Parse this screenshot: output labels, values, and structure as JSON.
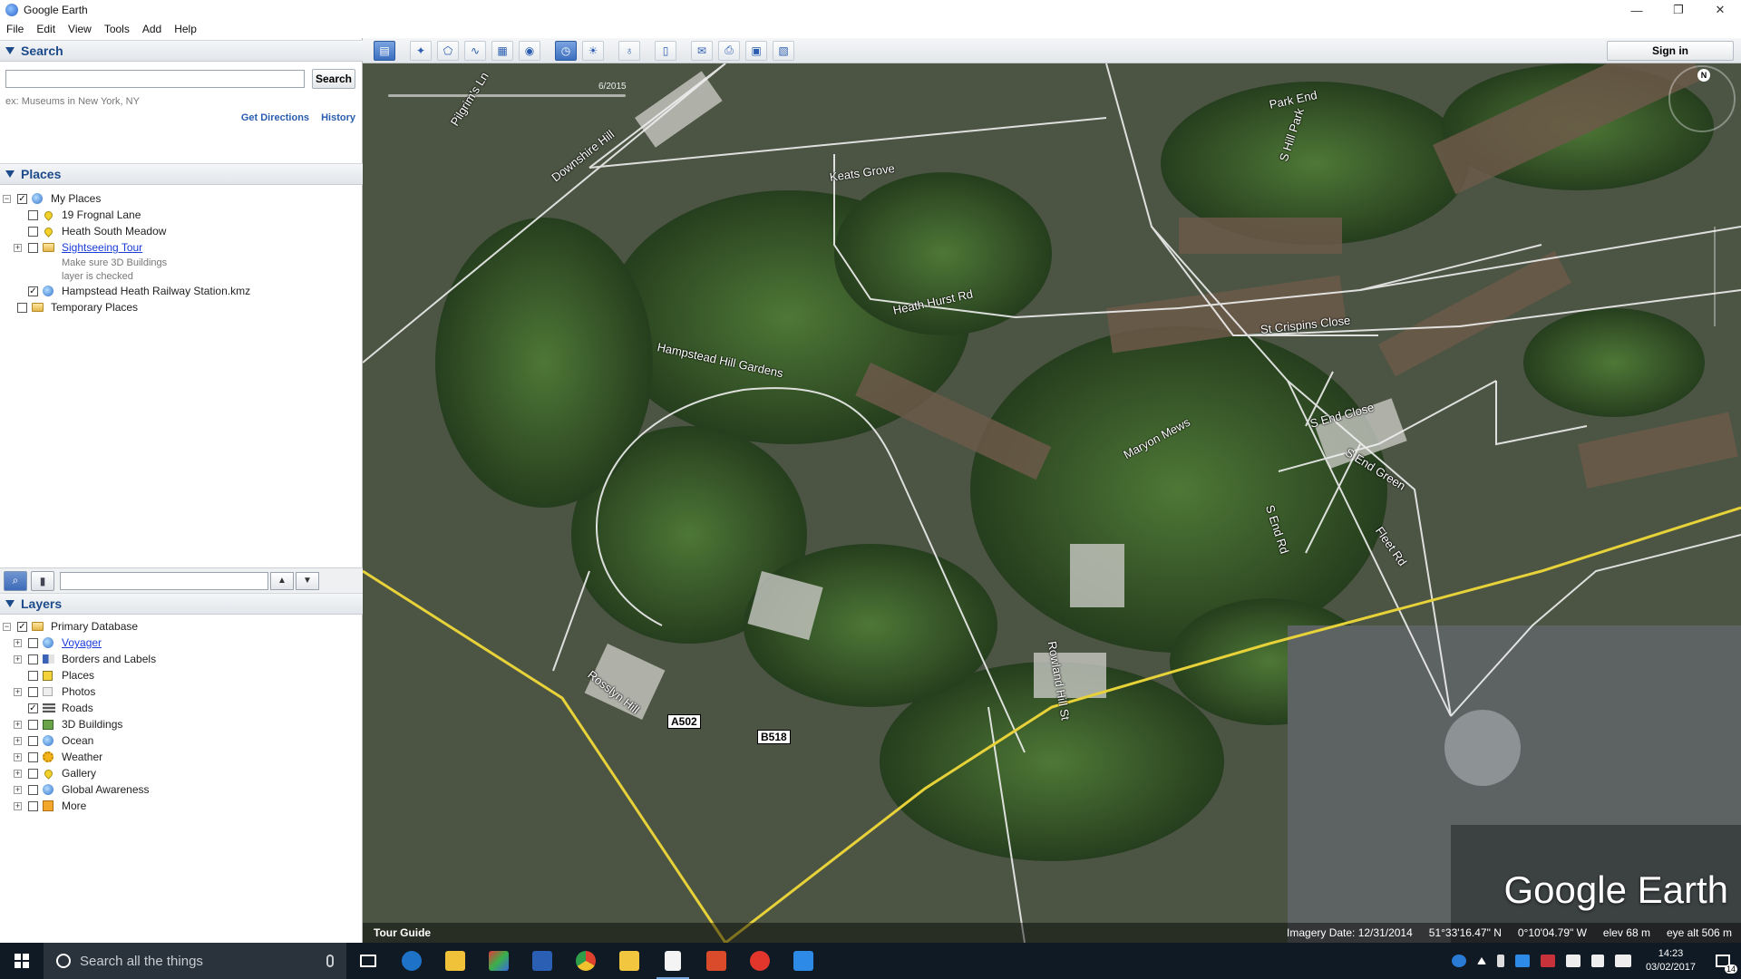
{
  "window": {
    "title": "Google Earth",
    "controls": [
      "—",
      "❐",
      "✕"
    ]
  },
  "menu": [
    "File",
    "Edit",
    "View",
    "Tools",
    "Add",
    "Help"
  ],
  "search": {
    "header": "Search",
    "button_label": "Search",
    "placeholder": "",
    "hint": "ex: Museums in New York, NY",
    "get_directions": "Get Directions",
    "history": "History"
  },
  "places": {
    "header": "Places",
    "my_places": "My Places",
    "items": [
      {
        "label": "19 Frognal Lane"
      },
      {
        "label": "Heath South Meadow"
      },
      {
        "label": "Sightseeing Tour",
        "note1": "Make sure 3D Buildings",
        "note2": "layer is checked"
      },
      {
        "label": "Hampstead Heath Railway Station.kmz"
      }
    ],
    "temporary": "Temporary Places"
  },
  "layers": {
    "header": "Layers",
    "primary": "Primary Database",
    "items": [
      {
        "label": "Voyager",
        "checked": false
      },
      {
        "label": "Borders and Labels",
        "checked": false
      },
      {
        "label": "Places",
        "checked": false
      },
      {
        "label": "Photos",
        "checked": false
      },
      {
        "label": "Roads",
        "checked": true
      },
      {
        "label": "3D Buildings",
        "checked": false
      },
      {
        "label": "Ocean",
        "checked": false
      },
      {
        "label": "Weather",
        "checked": false
      },
      {
        "label": "Gallery",
        "checked": false
      },
      {
        "label": "Global Awareness",
        "checked": false
      },
      {
        "label": "More",
        "checked": false
      }
    ]
  },
  "toolbar": {
    "signin": "Sign in"
  },
  "map": {
    "timeline_date": "6/2015",
    "compass_north": "N",
    "watermark": "Google Earth",
    "tour_guide": "Tour Guide",
    "imagery_date": "Imagery Date: 12/31/2014",
    "lat": "51°33'16.47\" N",
    "lon": "0°10'04.79\" W",
    "elev": "elev   68 m",
    "eye_alt": "eye alt   506 m",
    "roads": {
      "keats_grove": "Keats Grove",
      "downshire_hill": "Downshire Hill",
      "pilgrims_ln": "Pilgrim's Ln",
      "heath_hurst_rd": "Heath Hurst Rd",
      "hampstead_hill_gardens": "Hampstead Hill Gardens",
      "st_crispins_close": "St Crispins Close",
      "maryon_mews": "Maryon Mews",
      "s_end_close": "S End Close",
      "s_end_green": "S End Green",
      "s_end_rd": "S End Rd",
      "fleet_rd": "Fleet Rd",
      "park_end": "Park End",
      "south_hill_park": "S Hill Park",
      "rosslyn_hill": "Rosslyn Hill",
      "rowland_hill": "Rowland Hill St",
      "a502": "A502",
      "b518": "B518"
    }
  },
  "taskbar": {
    "search_placeholder": "Search all the things",
    "time": "14:23",
    "date": "03/02/2017",
    "notif_count": "14"
  },
  "colors": {
    "accent": "#1c4a8a",
    "link": "#1a3bd8",
    "road_major": "#e8d23a",
    "road_minor": "#f2f2f2"
  }
}
